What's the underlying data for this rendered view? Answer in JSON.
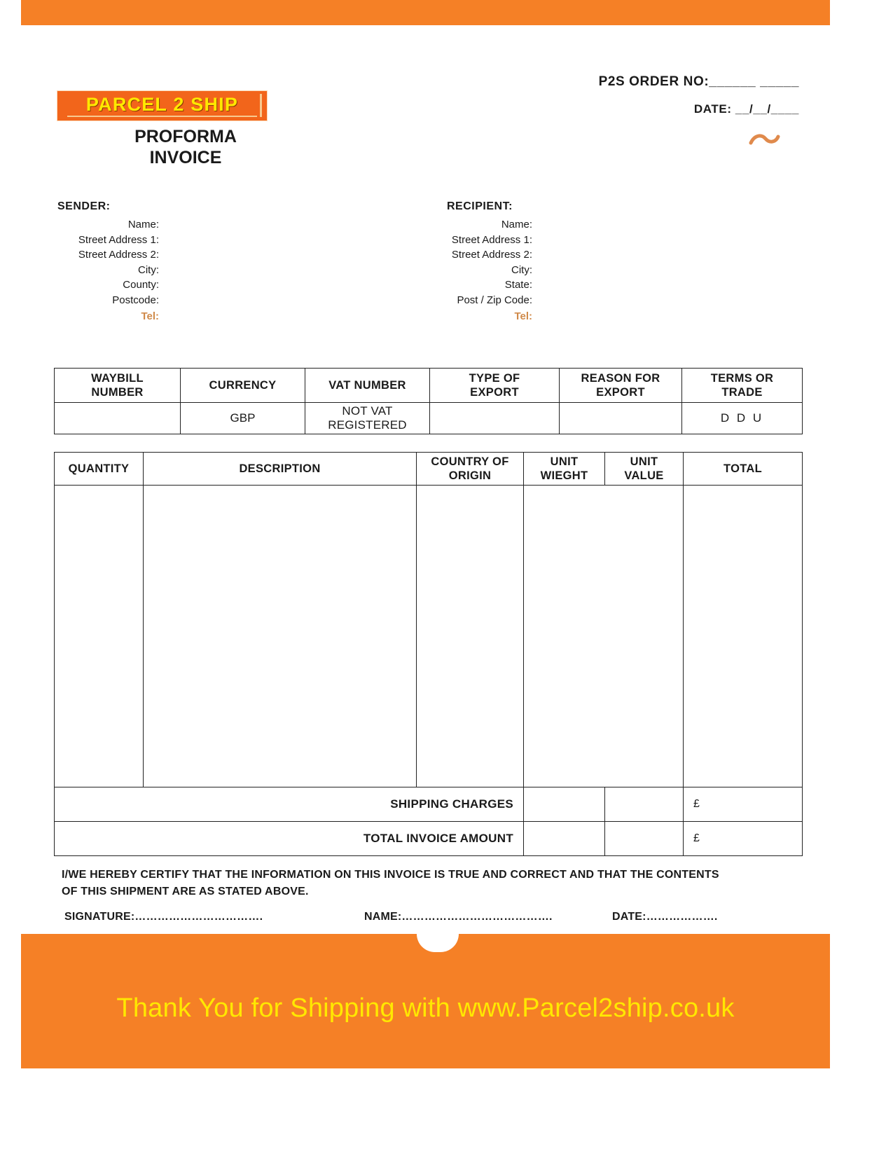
{
  "brand": {
    "logo_text": "PARCEL 2 SHIP",
    "document_title_line1": "PROFORMA",
    "document_title_line2": "INVOICE",
    "accent_color": "#f58026",
    "logo_bg_color": "#f2651b",
    "logo_text_color": "#ffe800",
    "tel_color": "#d08a4a"
  },
  "header": {
    "order_no_label": "P2S ORDER NO:______ _____",
    "date_label": "DATE:  __/__/____",
    "swoosh_icon": "swoosh-icon"
  },
  "sender": {
    "title": "SENDER:",
    "fields": [
      "Name:",
      "Street Address 1:",
      "Street Address 2:",
      "City:",
      "County:",
      "Postcode:"
    ],
    "tel": "Tel:"
  },
  "recipient": {
    "title": "RECIPIENT:",
    "fields": [
      "Name:",
      "Street Address 1:",
      "Street Address 2:",
      "City:",
      "State:",
      "Post / Zip Code:"
    ],
    "tel": "Tel:"
  },
  "meta_table": {
    "headers": [
      "WAYBILL NUMBER",
      "CURRENCY",
      "VAT NUMBER",
      "TYPE OF EXPORT",
      "REASON FOR EXPORT",
      "TERMS OR TRADE"
    ],
    "headers_split": [
      [
        "WAYBILL",
        "NUMBER"
      ],
      [
        "CURRENCY",
        ""
      ],
      [
        "VAT NUMBER",
        ""
      ],
      [
        "TYPE OF",
        "EXPORT"
      ],
      [
        "REASON FOR",
        "EXPORT"
      ],
      [
        "TERMS OR",
        "TRADE"
      ]
    ],
    "values": [
      "",
      "GBP",
      "NOT VAT REGISTERED",
      "",
      "",
      "D D U"
    ]
  },
  "items_table": {
    "headers_split": [
      [
        "QUANTITY",
        ""
      ],
      [
        "DESCRIPTION",
        ""
      ],
      [
        "COUNTRY OF",
        "ORIGIN"
      ],
      [
        "UNIT",
        "WIEGHT"
      ],
      [
        "UNIT",
        "VALUE"
      ],
      [
        "TOTAL",
        ""
      ]
    ],
    "rows": [],
    "shipping_charges_label": "SHIPPING CHARGES",
    "shipping_charges_unit_weight": "",
    "shipping_charges_unit_value": "",
    "shipping_charges_total": "£",
    "total_invoice_label": "TOTAL INVOICE AMOUNT",
    "total_invoice_unit_weight": "",
    "total_invoice_unit_value": "",
    "total_invoice_total": "£"
  },
  "certification": {
    "line1": "I/WE HEREBY CERTIFY THAT THE INFORMATION ON THIS INVOICE IS TRUE AND CORRECT AND THAT THE CONTENTS",
    "line2": "OF THIS SHIPMENT ARE AS STATED ABOVE.",
    "signature_label": "SIGNATURE:…………………………….",
    "name_label": "NAME:………………………………….",
    "date_label": "DATE:………………."
  },
  "footer": {
    "thank_you": "Thank You for Shipping with www.Parcel2ship.co.uk"
  }
}
